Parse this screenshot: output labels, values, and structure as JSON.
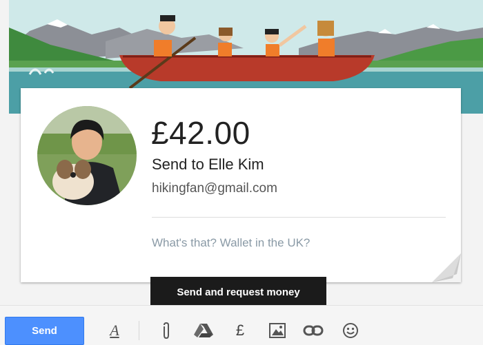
{
  "payment": {
    "amount": "£42.00",
    "recipient": "Send to Elle Kim",
    "email": "hikingfan@gmail.com",
    "memo": "What's that? Wallet in the UK?"
  },
  "tooltip": {
    "text": "Send and request money"
  },
  "toolbar": {
    "send_label": "Send",
    "format_icon_glyph": "A",
    "money_icon_glyph": "£",
    "icons": [
      "format-text-icon",
      "attach-icon",
      "drive-icon",
      "pound-icon",
      "photo-icon",
      "link-icon",
      "emoji-icon"
    ],
    "send_color": "#4d90fe"
  },
  "banner": {
    "illustration": "canoe-trip-illustration"
  }
}
